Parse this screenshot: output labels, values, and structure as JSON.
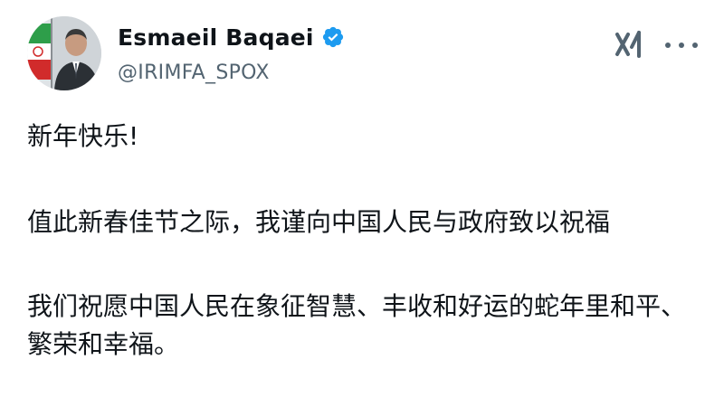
{
  "author": {
    "display_name": "Esmaeil Baqaei",
    "handle": "@IRIMFA_SPOX",
    "verified": true
  },
  "icons": {
    "avatar": "profile-photo",
    "verified": "verified-badge-icon",
    "grok": "grok-icon",
    "more": "more-options-icon"
  },
  "colors": {
    "verified_blue": "#1d9bf0",
    "text_primary": "#0f1419",
    "text_secondary": "#536471"
  },
  "tweet": {
    "line1": "新年快乐!",
    "line2": "值此新春佳节之际，我谨向中国人民与政府致以祝福",
    "line3": "我们祝愿中国人民在象征智慧、丰收和好运的蛇年里和平、繁荣和幸福。"
  }
}
